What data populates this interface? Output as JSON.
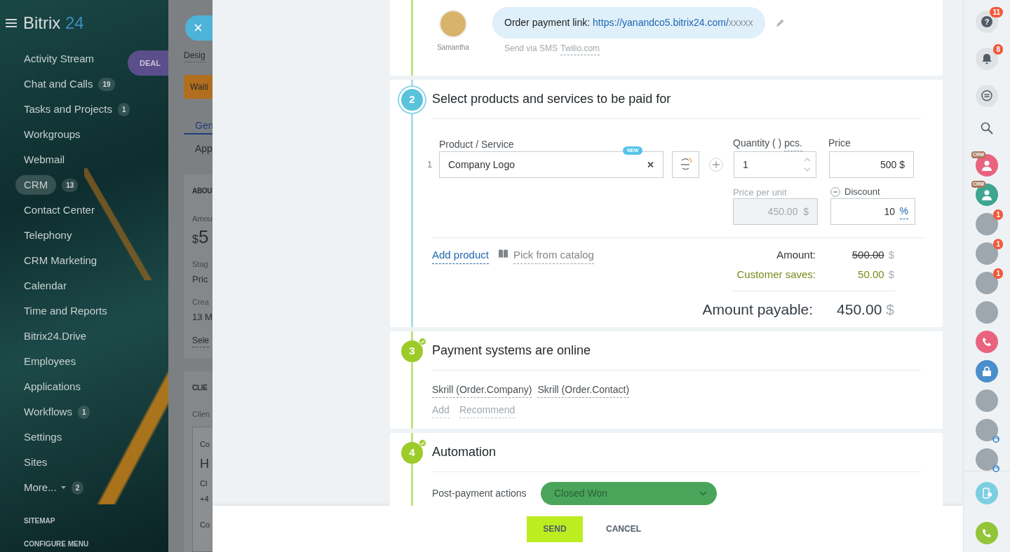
{
  "sidebar": {
    "logo_main": "Bitrix",
    "logo_accent": "24",
    "items": [
      {
        "label": "Activity Stream",
        "selected": false
      },
      {
        "label": "Chat and Calls",
        "counter": "19",
        "selected": false
      },
      {
        "label": "Tasks and Projects",
        "counter": "1",
        "selected": false
      },
      {
        "label": "Workgroups",
        "selected": false
      },
      {
        "label": "Webmail",
        "selected": false
      },
      {
        "label": "CRM",
        "counter": "13",
        "selected": true
      },
      {
        "label": "Contact Center",
        "selected": false
      },
      {
        "label": "Telephony",
        "selected": false
      },
      {
        "label": "CRM Marketing",
        "selected": false
      },
      {
        "label": "Calendar",
        "selected": false
      },
      {
        "label": "Time and Reports",
        "selected": false
      },
      {
        "label": "Bitrix24.Drive",
        "selected": false
      },
      {
        "label": "Employees",
        "selected": false
      },
      {
        "label": "Applications",
        "selected": false
      },
      {
        "label": "Workflows",
        "counter": "1",
        "selected": false
      },
      {
        "label": "Settings",
        "selected": false
      },
      {
        "label": "Sites",
        "selected": false
      },
      {
        "label": "More...",
        "counter": "2",
        "dropdown": true,
        "selected": false
      }
    ],
    "footer_links": [
      "SITEMAP",
      "CONFIGURE MENU"
    ]
  },
  "background_page": {
    "close_label": "×",
    "deal_tab": "DEAL",
    "action_link": "Desig",
    "stage_button": "Waiti",
    "tabs": [
      {
        "label": "Gen",
        "selected": true
      },
      {
        "label": "App",
        "selected": false
      }
    ],
    "about": {
      "title": "ABOU",
      "amount_label": "Amou",
      "amount_currency": "$",
      "amount": "5",
      "stage_label": "Stag",
      "stage": "Pric",
      "created_label": "Crea",
      "created": "13 M",
      "select_link": "Sele"
    },
    "client": {
      "title": "CLIE",
      "label": "Clien",
      "card_lines": [
        "Co",
        "H",
        "Cl",
        "+4",
        "Co"
      ]
    }
  },
  "message": {
    "sender": "Samantha",
    "text": "Order payment link: ",
    "url": "https://yanandco5.bitrix24.com/",
    "url_suffix": "xxxxx",
    "via_label": "Send via SMS",
    "via_provider": "Twilio.com"
  },
  "products_step": {
    "number": "2",
    "completed": false,
    "title": "Select products and services to be paid for",
    "product_label": "Product / Service",
    "quantity_label": "Quantity ( )",
    "quantity_unit": "pcs.",
    "price_label": "Price",
    "rows": [
      {
        "number": "1",
        "name": "Company Logo",
        "badge": "NEW",
        "quantity": "1",
        "price": "500",
        "currency": "$",
        "unit_price_label": "Price per unit",
        "unit_price": "450.00",
        "unit_currency": "$",
        "discount_label": "Discount",
        "discount": "10",
        "discount_unit": "%"
      }
    ],
    "add_link": "Add product",
    "catalog_link": "Pick from catalog",
    "totals": [
      {
        "kind": "amount",
        "label": "Amount:",
        "value": "500.00",
        "currency": "$",
        "struck": true
      },
      {
        "kind": "saves",
        "label": "Customer saves:",
        "value": "50.00",
        "currency": "$",
        "struck": false
      }
    ],
    "payable_label": "Amount payable:",
    "payable_value": "450.00",
    "payable_currency": "$"
  },
  "payment_step": {
    "number": "3",
    "completed": true,
    "title": "Payment systems are online",
    "systems": [
      "Skrill (Order.Company)",
      "Skrill (Order.Contact)"
    ],
    "actions": [
      "Add",
      "Recommend"
    ]
  },
  "automation_step": {
    "number": "4",
    "completed": true,
    "title": "Automation",
    "action_label": "Post-payment actions",
    "stage": "Closed Won"
  },
  "footer": {
    "send": "SEND",
    "cancel": "CANCEL"
  },
  "right_bar": {
    "items": [
      {
        "kind": "help",
        "glyph": "?",
        "counter": "11"
      },
      {
        "kind": "notifications",
        "counter": "8"
      },
      {
        "kind": "chat"
      },
      {
        "kind": "search"
      },
      {
        "kind": "crm_contact",
        "tag": "CRM",
        "color": "#e9637f"
      },
      {
        "kind": "crm_contact",
        "tag": "CRM",
        "color": "#3ea592"
      },
      {
        "kind": "photo",
        "counter": "1"
      },
      {
        "kind": "photo",
        "counter": "1"
      },
      {
        "kind": "photo",
        "counter": "1"
      },
      {
        "kind": "photo"
      },
      {
        "kind": "call",
        "color": "#e9637f"
      },
      {
        "kind": "lock",
        "color": "#4a8fcb"
      },
      {
        "kind": "photo"
      },
      {
        "kind": "photo",
        "locked": true
      },
      {
        "kind": "photo",
        "locked": true
      }
    ],
    "bottom_items": [
      {
        "kind": "device",
        "color": "#7ccfe0"
      },
      {
        "kind": "call",
        "color": "#93c43a"
      }
    ]
  }
}
